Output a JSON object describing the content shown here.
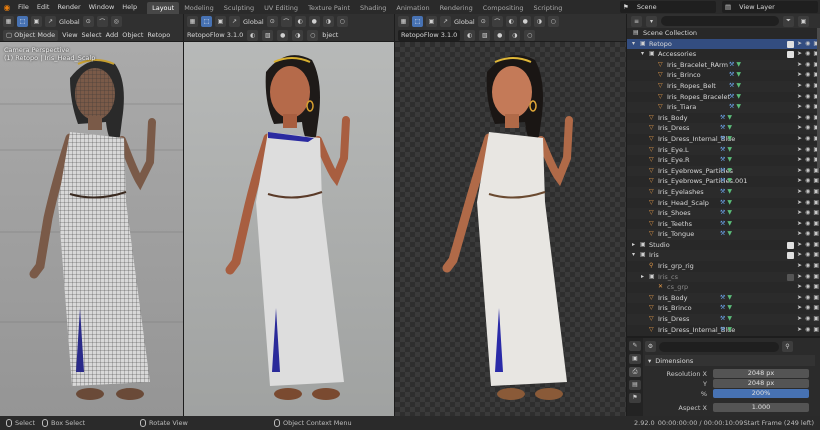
{
  "menu": {
    "items": [
      "File",
      "Edit",
      "Render",
      "Window",
      "Help"
    ],
    "workspaces": [
      "Layout",
      "Modeling",
      "Sculpting",
      "UV Editing",
      "Texture Paint",
      "Shading",
      "Animation",
      "Rendering",
      "Compositing",
      "Scripting"
    ],
    "active_workspace": "Layout"
  },
  "scene": {
    "name": "Scene",
    "view_layer": "View Layer"
  },
  "viewport_header": {
    "transform": "Global",
    "mode": "Object Mode",
    "view": "View",
    "select": "Select",
    "add": "Add",
    "object": "Object",
    "addon": "Retopo",
    "addon2": "RetopoFlow 3.1.0",
    "object_short": "bject"
  },
  "viewport1": {
    "line1": "Camera Perspective",
    "line2": "(1) Retopo | Iris_Head_Scalp"
  },
  "outliner": {
    "root": "Scene Collection",
    "rows": [
      {
        "name": "Retopo",
        "indent": 1,
        "icon": "collection-icon",
        "selected": true,
        "expanded": true
      },
      {
        "name": "Accessories",
        "indent": 2,
        "icon": "collection-icon",
        "expanded": true
      },
      {
        "name": "Iris_Bracelet_RArm",
        "indent": 3,
        "icon": "mesh-icon"
      },
      {
        "name": "Iris_Brinco",
        "indent": 3,
        "icon": "mesh-icon"
      },
      {
        "name": "Iris_Ropes_Belt",
        "indent": 3,
        "icon": "mesh-icon"
      },
      {
        "name": "Iris_Ropes_Bracelet",
        "indent": 3,
        "icon": "mesh-icon"
      },
      {
        "name": "Iris_Tiara",
        "indent": 3,
        "icon": "mesh-icon"
      },
      {
        "name": "Iris_Body",
        "indent": 2,
        "icon": "mesh-icon"
      },
      {
        "name": "Iris_Dress",
        "indent": 2,
        "icon": "mesh-icon"
      },
      {
        "name": "Iris_Dress_Internal_Blue",
        "indent": 2,
        "icon": "mesh-icon"
      },
      {
        "name": "Iris_Eye.L",
        "indent": 2,
        "icon": "mesh-icon"
      },
      {
        "name": "Iris_Eye.R",
        "indent": 2,
        "icon": "mesh-icon"
      },
      {
        "name": "Iris_Eyebrows_Particles",
        "indent": 2,
        "icon": "mesh-icon"
      },
      {
        "name": "Iris_Eyebrows_Particles.001",
        "indent": 2,
        "icon": "mesh-icon"
      },
      {
        "name": "Iris_Eyelashes",
        "indent": 2,
        "icon": "mesh-icon"
      },
      {
        "name": "Iris_Head_Scalp",
        "indent": 2,
        "icon": "mesh-icon"
      },
      {
        "name": "Iris_Shoes",
        "indent": 2,
        "icon": "mesh-icon"
      },
      {
        "name": "Iris_Teeths",
        "indent": 2,
        "icon": "mesh-icon"
      },
      {
        "name": "Iris_Tongue",
        "indent": 2,
        "icon": "mesh-icon"
      },
      {
        "name": "Studio",
        "indent": 1,
        "icon": "collection-icon"
      },
      {
        "name": "Iris",
        "indent": 1,
        "icon": "collection-icon",
        "expanded": true
      },
      {
        "name": "Iris_grp_rig",
        "indent": 2,
        "icon": "armature-icon"
      },
      {
        "name": "Iris_cs",
        "indent": 2,
        "icon": "collection-icon",
        "dim": true
      },
      {
        "name": "cs_grp",
        "indent": 3,
        "icon": "empty-icon",
        "dim": true
      },
      {
        "name": "Iris_Body",
        "indent": 2,
        "icon": "mesh-icon"
      },
      {
        "name": "Iris_Brinco",
        "indent": 2,
        "icon": "mesh-icon"
      },
      {
        "name": "Iris_Dress",
        "indent": 2,
        "icon": "mesh-icon"
      },
      {
        "name": "Iris_Dress_Internal_Blue",
        "indent": 2,
        "icon": "mesh-icon"
      }
    ]
  },
  "properties": {
    "panel": "Dimensions",
    "rows": [
      {
        "label": "Resolution X",
        "value": "2048 px"
      },
      {
        "label": "Y",
        "value": "2048 px"
      },
      {
        "label": "%",
        "value": "200%",
        "highlight": true
      },
      {
        "label": "Aspect X",
        "value": "1.000"
      }
    ]
  },
  "statusbar": {
    "select": "Select",
    "box_select": "Box Select",
    "rotate_view": "Rotate View",
    "context_menu": "Object Context Menu",
    "version": "2.92.0",
    "timecode": "00:00:00:00 / 00:00:10:09",
    "frame": "Start Frame (249 left)"
  },
  "colors": {
    "accent": "#4772b3",
    "active_tab": "#474747",
    "selected_row": "#334d80",
    "blender_orange": "#e87d0d"
  }
}
